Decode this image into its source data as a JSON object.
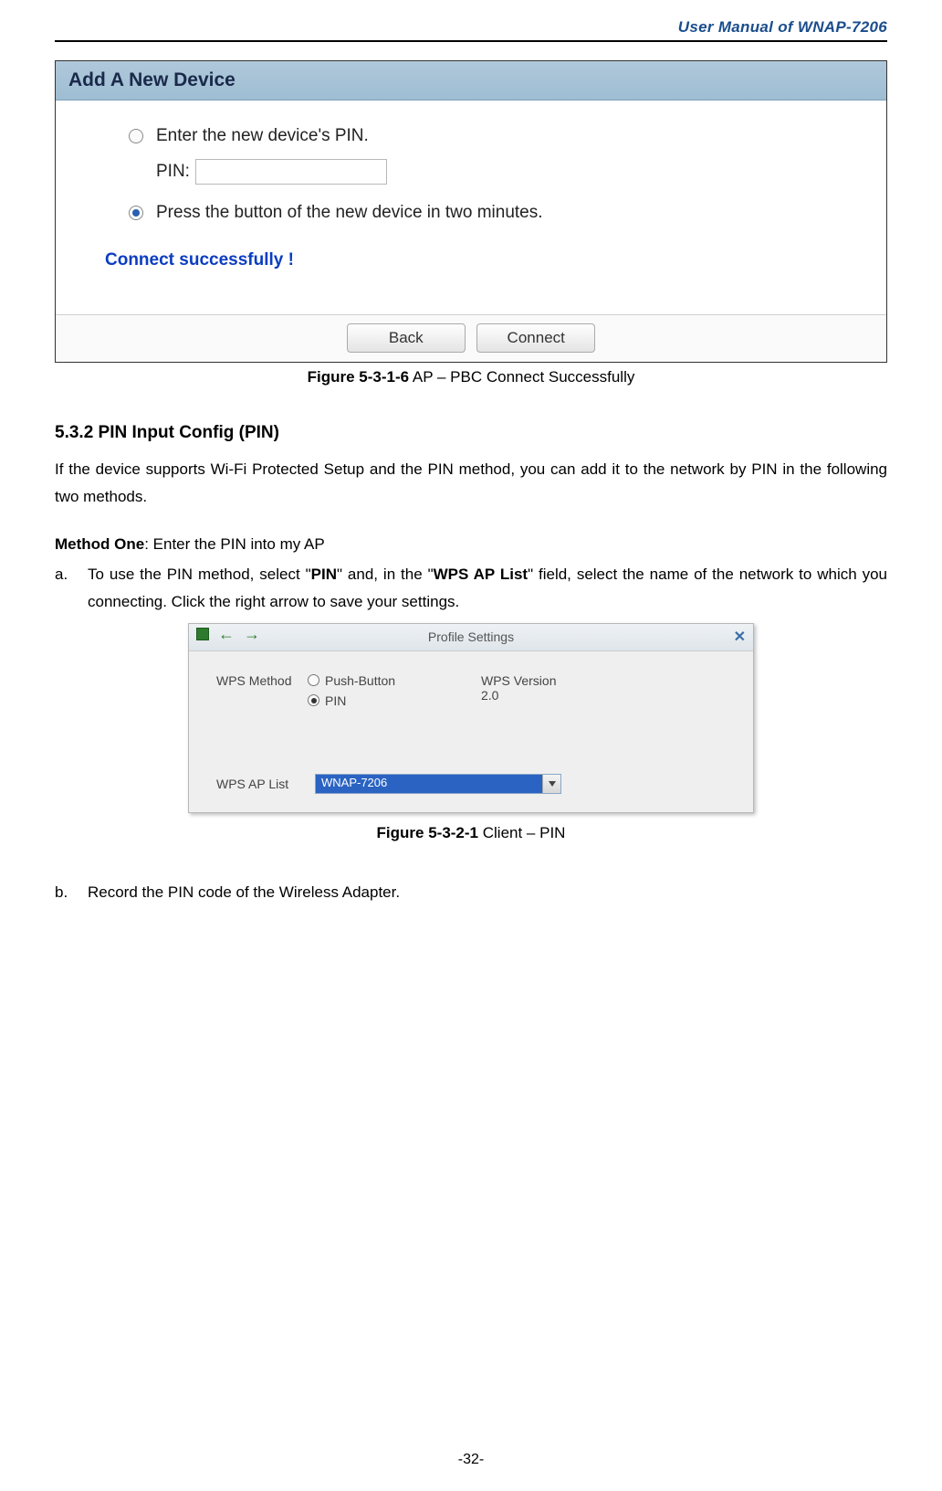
{
  "header": {
    "title": "User Manual of WNAP-7206"
  },
  "figure1": {
    "panel_title": "Add A New Device",
    "option1": "Enter the new device's PIN.",
    "pin_label": "PIN:",
    "pin_value": "",
    "option2": "Press the button of the new device in two minutes.",
    "success": "Connect successfully !",
    "btn_back": "Back",
    "btn_connect": "Connect",
    "caption_bold": "Figure 5-3-1-6",
    "caption_rest": " AP – PBC Connect Successfully"
  },
  "section": {
    "heading": "5.3.2   PIN Input Config (PIN)",
    "intro": "If the device supports Wi-Fi Protected Setup and the PIN method, you can add it to the network by PIN in the following two methods.",
    "method_one_label": "Method One",
    "method_one_rest": ": Enter the PIN into my AP",
    "item_a_marker": "a.",
    "item_a_pre": "To use the PIN method, select \"",
    "item_a_bold1": "PIN",
    "item_a_mid": "\" and, in the \"",
    "item_a_bold2": "WPS AP List",
    "item_a_post": "\" field, select the name of the network to which you connecting. Click the right arrow to save your settings.",
    "item_b_marker": "b.",
    "item_b_text": "Record the PIN code of the Wireless Adapter."
  },
  "figure2": {
    "title": "Profile Settings",
    "wps_method_label": "WPS Method",
    "opt_push": "Push-Button",
    "opt_pin": "PIN",
    "wps_version_label": "WPS Version",
    "wps_version_value": "2.0",
    "wps_aplist_label": "WPS AP List",
    "wps_aplist_value": "WNAP-7206",
    "caption_bold": "Figure 5-3-2-1",
    "caption_rest": " Client – PIN"
  },
  "footer": {
    "page": "-32-"
  }
}
